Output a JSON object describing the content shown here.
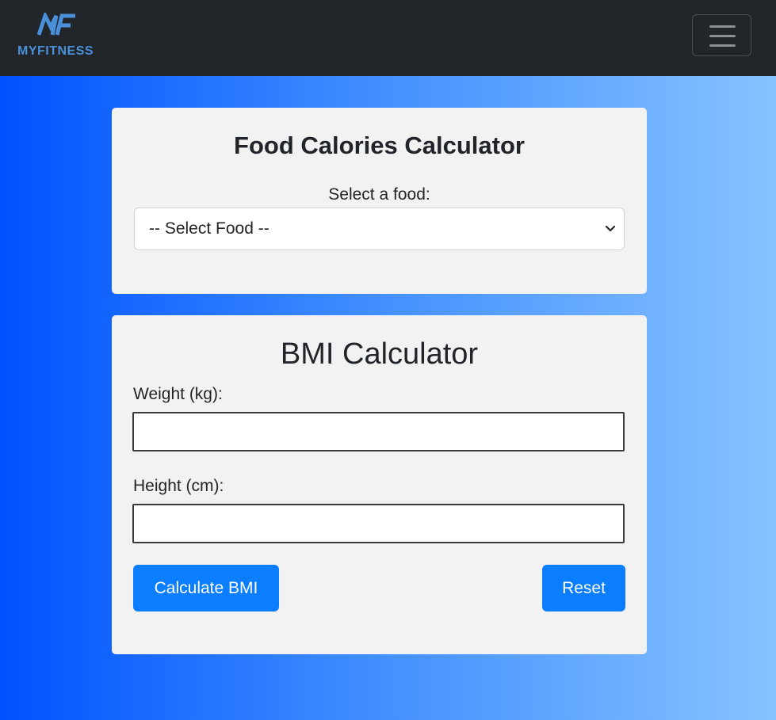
{
  "navbar": {
    "brand_name": "MYFITNESS",
    "logo_mark": "MF",
    "menu_icon": "hamburger-icon"
  },
  "food_card": {
    "title": "Food Calories Calculator",
    "select_label": "Select a food:",
    "select_value": "-- Select Food --"
  },
  "bmi_card": {
    "title": "BMI Calculator",
    "weight_label": "Weight (kg):",
    "weight_value": "",
    "height_label": "Height (cm):",
    "height_value": "",
    "calculate_label": "Calculate BMI",
    "reset_label": "Reset"
  },
  "colors": {
    "navbar_bg": "#212529",
    "brand": "#4a90d9",
    "button": "#0a7eff",
    "card_bg": "#f2f2f2",
    "gradient_start": "#0052ff",
    "gradient_end": "#86c3ff"
  }
}
